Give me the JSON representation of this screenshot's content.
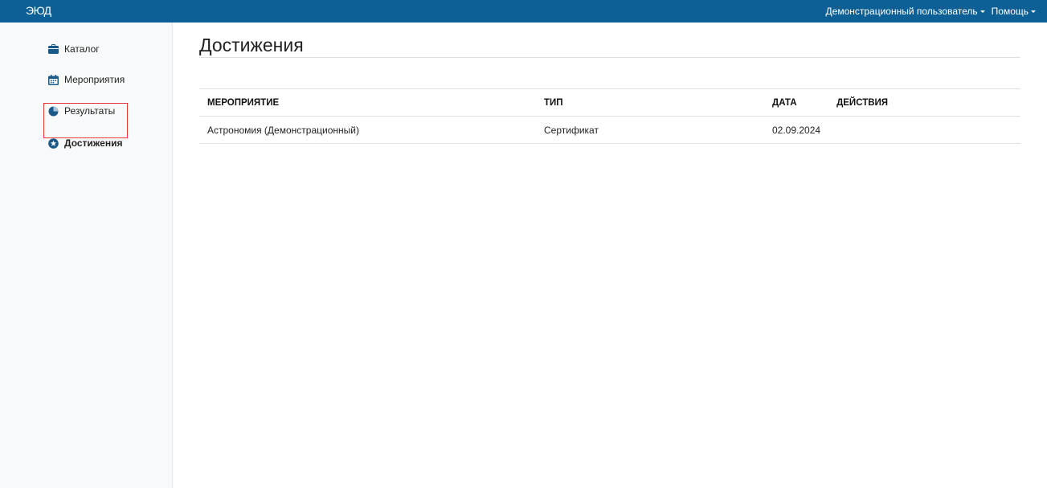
{
  "app": {
    "brand": "ЭЮД"
  },
  "navbar": {
    "user_menu_label": "Демонстрационный пользователь",
    "help_menu_label": "Помощь"
  },
  "sidebar": {
    "items": [
      {
        "label": "Каталог",
        "icon": "briefcase-icon"
      },
      {
        "label": "Мероприятия",
        "icon": "calendar-icon"
      },
      {
        "label": "Результаты",
        "icon": "pie-chart-icon"
      },
      {
        "label": "Достижения",
        "icon": "star-circle-icon",
        "active": true
      }
    ]
  },
  "main": {
    "title": "Достижения",
    "table": {
      "headers": [
        "МЕРОПРИЯТИЕ",
        "ТИП",
        "ДАТА",
        "ДЕЙСТВИЯ"
      ],
      "rows": [
        [
          "Астрономия (Демонстрационный)",
          "Сертификат",
          "02.09.2024",
          ""
        ]
      ]
    }
  },
  "colors": {
    "navbar": "#0c6096",
    "sidebar_bg": "#f8f9fa",
    "active_frame": "#e53935",
    "icon": "#1a5a8a"
  }
}
